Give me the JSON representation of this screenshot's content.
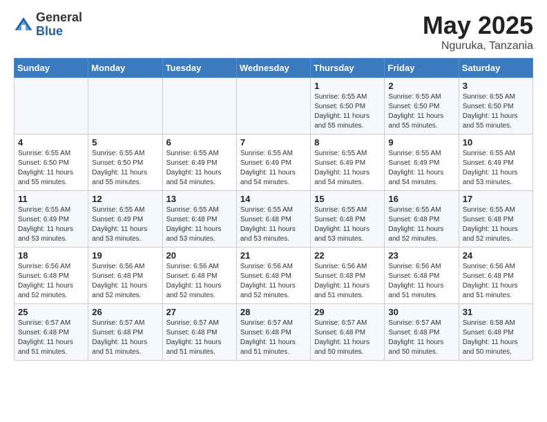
{
  "header": {
    "logo_general": "General",
    "logo_blue": "Blue",
    "main_title": "May 2025",
    "sub_title": "Nguruka, Tanzania"
  },
  "weekdays": [
    "Sunday",
    "Monday",
    "Tuesday",
    "Wednesday",
    "Thursday",
    "Friday",
    "Saturday"
  ],
  "weeks": [
    [
      {
        "day": "",
        "info": ""
      },
      {
        "day": "",
        "info": ""
      },
      {
        "day": "",
        "info": ""
      },
      {
        "day": "",
        "info": ""
      },
      {
        "day": "1",
        "info": "Sunrise: 6:55 AM\nSunset: 6:50 PM\nDaylight: 11 hours\nand 55 minutes."
      },
      {
        "day": "2",
        "info": "Sunrise: 6:55 AM\nSunset: 6:50 PM\nDaylight: 11 hours\nand 55 minutes."
      },
      {
        "day": "3",
        "info": "Sunrise: 6:55 AM\nSunset: 6:50 PM\nDaylight: 11 hours\nand 55 minutes."
      }
    ],
    [
      {
        "day": "4",
        "info": "Sunrise: 6:55 AM\nSunset: 6:50 PM\nDaylight: 11 hours\nand 55 minutes."
      },
      {
        "day": "5",
        "info": "Sunrise: 6:55 AM\nSunset: 6:50 PM\nDaylight: 11 hours\nand 55 minutes."
      },
      {
        "day": "6",
        "info": "Sunrise: 6:55 AM\nSunset: 6:49 PM\nDaylight: 11 hours\nand 54 minutes."
      },
      {
        "day": "7",
        "info": "Sunrise: 6:55 AM\nSunset: 6:49 PM\nDaylight: 11 hours\nand 54 minutes."
      },
      {
        "day": "8",
        "info": "Sunrise: 6:55 AM\nSunset: 6:49 PM\nDaylight: 11 hours\nand 54 minutes."
      },
      {
        "day": "9",
        "info": "Sunrise: 6:55 AM\nSunset: 6:49 PM\nDaylight: 11 hours\nand 54 minutes."
      },
      {
        "day": "10",
        "info": "Sunrise: 6:55 AM\nSunset: 6:49 PM\nDaylight: 11 hours\nand 53 minutes."
      }
    ],
    [
      {
        "day": "11",
        "info": "Sunrise: 6:55 AM\nSunset: 6:49 PM\nDaylight: 11 hours\nand 53 minutes."
      },
      {
        "day": "12",
        "info": "Sunrise: 6:55 AM\nSunset: 6:49 PM\nDaylight: 11 hours\nand 53 minutes."
      },
      {
        "day": "13",
        "info": "Sunrise: 6:55 AM\nSunset: 6:48 PM\nDaylight: 11 hours\nand 53 minutes."
      },
      {
        "day": "14",
        "info": "Sunrise: 6:55 AM\nSunset: 6:48 PM\nDaylight: 11 hours\nand 53 minutes."
      },
      {
        "day": "15",
        "info": "Sunrise: 6:55 AM\nSunset: 6:48 PM\nDaylight: 11 hours\nand 53 minutes."
      },
      {
        "day": "16",
        "info": "Sunrise: 6:55 AM\nSunset: 6:48 PM\nDaylight: 11 hours\nand 52 minutes."
      },
      {
        "day": "17",
        "info": "Sunrise: 6:55 AM\nSunset: 6:48 PM\nDaylight: 11 hours\nand 52 minutes."
      }
    ],
    [
      {
        "day": "18",
        "info": "Sunrise: 6:56 AM\nSunset: 6:48 PM\nDaylight: 11 hours\nand 52 minutes."
      },
      {
        "day": "19",
        "info": "Sunrise: 6:56 AM\nSunset: 6:48 PM\nDaylight: 11 hours\nand 52 minutes."
      },
      {
        "day": "20",
        "info": "Sunrise: 6:56 AM\nSunset: 6:48 PM\nDaylight: 11 hours\nand 52 minutes."
      },
      {
        "day": "21",
        "info": "Sunrise: 6:56 AM\nSunset: 6:48 PM\nDaylight: 11 hours\nand 52 minutes."
      },
      {
        "day": "22",
        "info": "Sunrise: 6:56 AM\nSunset: 6:48 PM\nDaylight: 11 hours\nand 51 minutes."
      },
      {
        "day": "23",
        "info": "Sunrise: 6:56 AM\nSunset: 6:48 PM\nDaylight: 11 hours\nand 51 minutes."
      },
      {
        "day": "24",
        "info": "Sunrise: 6:56 AM\nSunset: 6:48 PM\nDaylight: 11 hours\nand 51 minutes."
      }
    ],
    [
      {
        "day": "25",
        "info": "Sunrise: 6:57 AM\nSunset: 6:48 PM\nDaylight: 11 hours\nand 51 minutes."
      },
      {
        "day": "26",
        "info": "Sunrise: 6:57 AM\nSunset: 6:48 PM\nDaylight: 11 hours\nand 51 minutes."
      },
      {
        "day": "27",
        "info": "Sunrise: 6:57 AM\nSunset: 6:48 PM\nDaylight: 11 hours\nand 51 minutes."
      },
      {
        "day": "28",
        "info": "Sunrise: 6:57 AM\nSunset: 6:48 PM\nDaylight: 11 hours\nand 51 minutes."
      },
      {
        "day": "29",
        "info": "Sunrise: 6:57 AM\nSunset: 6:48 PM\nDaylight: 11 hours\nand 50 minutes."
      },
      {
        "day": "30",
        "info": "Sunrise: 6:57 AM\nSunset: 6:48 PM\nDaylight: 11 hours\nand 50 minutes."
      },
      {
        "day": "31",
        "info": "Sunrise: 6:58 AM\nSunset: 6:48 PM\nDaylight: 11 hours\nand 50 minutes."
      }
    ]
  ]
}
